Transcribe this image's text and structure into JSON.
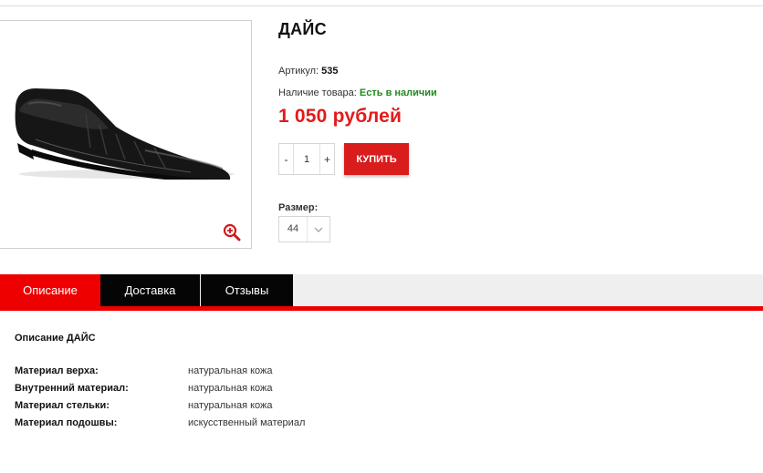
{
  "product": {
    "title": "ДАЙС",
    "sku_label": "Артикул:",
    "sku_value": "535",
    "stock_label": "Наличие товара:",
    "stock_value": "Есть в наличии",
    "price": "1 050 рублей"
  },
  "purchase": {
    "minus": "-",
    "quantity": "1",
    "plus": "+",
    "buy_label": "КУПИТЬ",
    "size_label": "Размер:",
    "size_value": "44"
  },
  "tabs": [
    {
      "label": "Описание",
      "active": true
    },
    {
      "label": "Доставка",
      "active": false
    },
    {
      "label": "Отзывы",
      "active": false
    }
  ],
  "description": {
    "title": "Описание ДАЙС",
    "specs": [
      {
        "key": "Материал верха:",
        "value": "натуральная кожа"
      },
      {
        "key": "Внутренний материал:",
        "value": "натуральная кожа"
      },
      {
        "key": "Материал стельки:",
        "value": "натуральная кожа"
      },
      {
        "key": "Материал подошвы:",
        "value": "искусственный материал"
      }
    ]
  },
  "colors": {
    "accent": "#ee0000",
    "buy_button": "#d91c1c",
    "price": "#e21b1b",
    "in_stock": "#1f8a1f",
    "tab_dark": "#050505"
  },
  "icons": {
    "zoom": "zoom-in-icon",
    "chevron": "chevron-down-icon"
  }
}
